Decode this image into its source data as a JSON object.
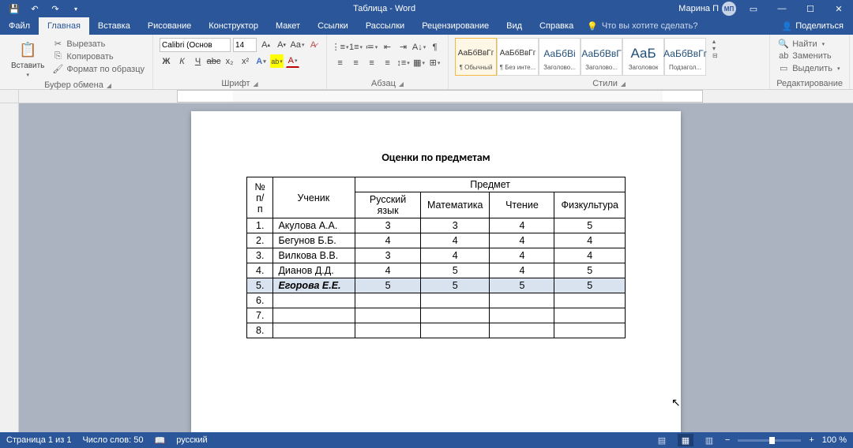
{
  "title": "Таблица  -  Word",
  "user": {
    "name": "Марина П",
    "initials": "МП"
  },
  "tabs": {
    "file": "Файл",
    "list": [
      "Главная",
      "Вставка",
      "Рисование",
      "Конструктор",
      "Макет",
      "Ссылки",
      "Рассылки",
      "Рецензирование",
      "Вид",
      "Справка"
    ],
    "active": 0
  },
  "tellme": "Что вы хотите сделать?",
  "share": "Поделиться",
  "clipboard": {
    "paste": "Вставить",
    "cut": "Вырезать",
    "copy": "Копировать",
    "format": "Формат по образцу",
    "group": "Буфер обмена"
  },
  "font": {
    "name": "Calibri (Основ",
    "size": "14",
    "group": "Шрифт"
  },
  "paragraph": {
    "group": "Абзац"
  },
  "styles": {
    "group": "Стили",
    "items": [
      {
        "preview": "АаБбВвГг",
        "name": "¶ Обычный",
        "cls": ""
      },
      {
        "preview": "АаБбВвГг",
        "name": "¶ Без инте...",
        "cls": ""
      },
      {
        "preview": "АаБбВі",
        "name": "Заголово...",
        "cls": "med"
      },
      {
        "preview": "АаБбВвГ",
        "name": "Заголово...",
        "cls": "med"
      },
      {
        "preview": "АаБ",
        "name": "Заголовок",
        "cls": "big"
      },
      {
        "preview": "АаБбВвГг",
        "name": "Подзагол...",
        "cls": "med"
      }
    ]
  },
  "editing": {
    "find": "Найти",
    "replace": "Заменить",
    "select": "Выделить",
    "group": "Редактирование"
  },
  "document": {
    "title": "Оценки по предметам",
    "headers": {
      "num": "№ п/п",
      "student": "Ученик",
      "subject": "Предмет",
      "russian": "Русский язык",
      "math": "Математика",
      "reading": "Чтение",
      "pe": "Физкультура"
    },
    "rows": [
      {
        "n": "1.",
        "name": "Акулова А.А.",
        "r": "3",
        "m": "3",
        "c": "4",
        "p": "5"
      },
      {
        "n": "2.",
        "name": "Бегунов Б.Б.",
        "r": "4",
        "m": "4",
        "c": "4",
        "p": "4"
      },
      {
        "n": "3.",
        "name": "Вилкова В.В.",
        "r": "3",
        "m": "4",
        "c": "4",
        "p": "4"
      },
      {
        "n": "4.",
        "name": "Дианов Д.Д.",
        "r": "4",
        "m": "5",
        "c": "4",
        "p": "5"
      },
      {
        "n": "5.",
        "name": "Егорова Е.Е.",
        "r": "5",
        "m": "5",
        "c": "5",
        "p": "5",
        "hl": true
      },
      {
        "n": "6.",
        "name": "",
        "r": "",
        "m": "",
        "c": "",
        "p": ""
      },
      {
        "n": "7.",
        "name": "",
        "r": "",
        "m": "",
        "c": "",
        "p": ""
      },
      {
        "n": "8.",
        "name": "",
        "r": "",
        "m": "",
        "c": "",
        "p": ""
      }
    ]
  },
  "status": {
    "page": "Страница 1 из 1",
    "words": "Число слов: 50",
    "lang": "русский",
    "zoom": "100 %"
  }
}
